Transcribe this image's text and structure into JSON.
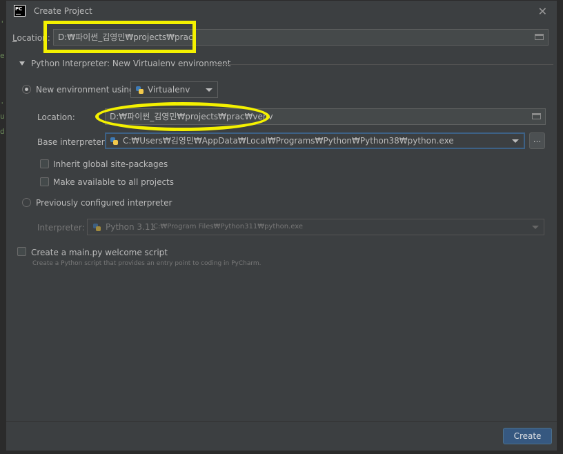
{
  "dialog": {
    "title": "Create Project",
    "app_icon_text": "PC",
    "close_glyph": "✕"
  },
  "location": {
    "label": "Location:",
    "value": "D:₩파이썬_김영민₩projects₩prac"
  },
  "interpreter_section": {
    "title": "Python Interpreter: New Virtualenv environment"
  },
  "new_env": {
    "radio_label": "New environment using",
    "selected": true,
    "tool": "Virtualenv",
    "location_label": "Location:",
    "location_value": "D:₩파이썬_김영민₩projects₩prac₩venv",
    "base_label": "Base interpreter:",
    "base_value": "C:₩Users₩김영민₩AppData₩Local₩Programs₩Python₩Python38₩python.exe",
    "browse_label": "...",
    "inherit_label": "Inherit global site-packages",
    "inherit_checked": false,
    "available_label": "Make available to all projects",
    "available_checked": false
  },
  "prev_config": {
    "radio_label": "Previously configured interpreter",
    "selected": false,
    "interpreter_label": "Interpreter:",
    "interpreter_name": "Python 3.11",
    "interpreter_path": "C:₩Program Files₩Python311₩python.exe"
  },
  "welcome": {
    "label": "Create a main.py welcome script",
    "checked": false,
    "hint": "Create a Python script that provides an entry point to coding in PyCharm."
  },
  "footer": {
    "create_label": "Create"
  },
  "background": {
    "strip_chars": [
      "'",
      "e",
      ".",
      "u",
      "d"
    ]
  },
  "colors": {
    "dialog_bg": "#3c3f41",
    "accent": "#365880",
    "focus": "#3d6185",
    "highlight": "#f4f100"
  },
  "icons": [
    "pycharm-icon",
    "close-icon",
    "folder-icon",
    "python-icon",
    "caret-down-icon",
    "collapse-triangle-icon"
  ]
}
